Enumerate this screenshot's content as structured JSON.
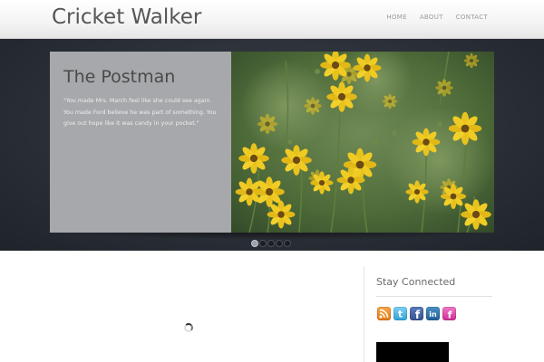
{
  "site": {
    "title": "Cricket Walker"
  },
  "nav": {
    "items": [
      {
        "label": "HOME"
      },
      {
        "label": "ABOUT"
      },
      {
        "label": "CONTACT"
      }
    ]
  },
  "slider": {
    "title": "The Postman",
    "quote": "\"You made Mrs. March feel like she could see again. You made Ford believe he was part of something. You give out hope like it was candy in your pocket.\"",
    "slide_count": 5,
    "active_index": 0
  },
  "sidebar": {
    "title": "Stay Connected",
    "social": [
      {
        "icon": "rss-icon",
        "color": "#f0892a"
      },
      {
        "icon": "twitter-icon",
        "color": "#3fb0e3"
      },
      {
        "icon": "facebook-icon",
        "color": "#3b5a9a"
      },
      {
        "icon": "linkedin-icon",
        "color": "#2a6fa8"
      },
      {
        "icon": "flickr-icon",
        "color": "#d93fa6"
      }
    ]
  },
  "colors": {
    "hero_bg": "#2b2f37",
    "slide_panel": "#a7a8ab",
    "flower": "#e8c21c"
  }
}
